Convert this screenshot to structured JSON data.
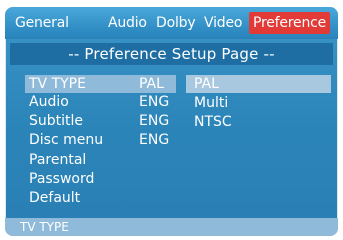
{
  "tabs": {
    "general": "General",
    "audio": "Audio",
    "dolby": "Dolby",
    "video": "Video",
    "preference": "Preference"
  },
  "header": {
    "title": "-- Preference Setup Page --"
  },
  "menu": {
    "items": [
      {
        "label": "TV TYPE",
        "value": "PAL",
        "selected": true
      },
      {
        "label": "Audio",
        "value": "ENG"
      },
      {
        "label": "Subtitle",
        "value": "ENG"
      },
      {
        "label": "Disc menu",
        "value": "ENG"
      },
      {
        "label": "Parental",
        "value": ""
      },
      {
        "label": "Password",
        "value": ""
      },
      {
        "label": "Default",
        "value": ""
      }
    ]
  },
  "options": {
    "items": [
      {
        "label": "PAL",
        "selected": true
      },
      {
        "label": "Multi"
      },
      {
        "label": "NTSC"
      }
    ]
  },
  "status": {
    "text": "TV TYPE"
  },
  "colors": {
    "background": "#2a84bb",
    "highlight": "#8fbad9",
    "activeTab": "#e23a37",
    "text": "#ffffff"
  }
}
